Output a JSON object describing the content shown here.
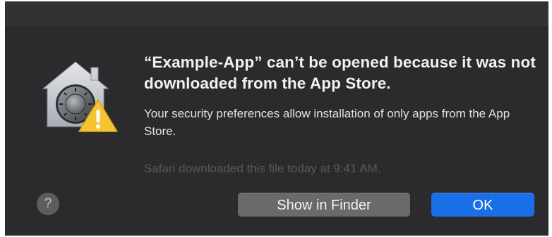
{
  "dialog": {
    "headline": "“Example-App” can’t be opened because it was not downloaded from the App Store.",
    "body": "Your security preferences allow installation of only apps from the App Store.",
    "note": "Safari downloaded this file today at 9:41 AM.",
    "icon": "security-preferences-house-icon",
    "warning_icon": "warning-triangle-icon"
  },
  "buttons": {
    "help_label": "?",
    "secondary_label": "Show in Finder",
    "primary_label": "OK"
  },
  "colors": {
    "dialog_background": "#2b2b2d",
    "primary_button": "#1a6fe6",
    "secondary_button": "#6a6a6d",
    "warning": "#f5c431"
  }
}
